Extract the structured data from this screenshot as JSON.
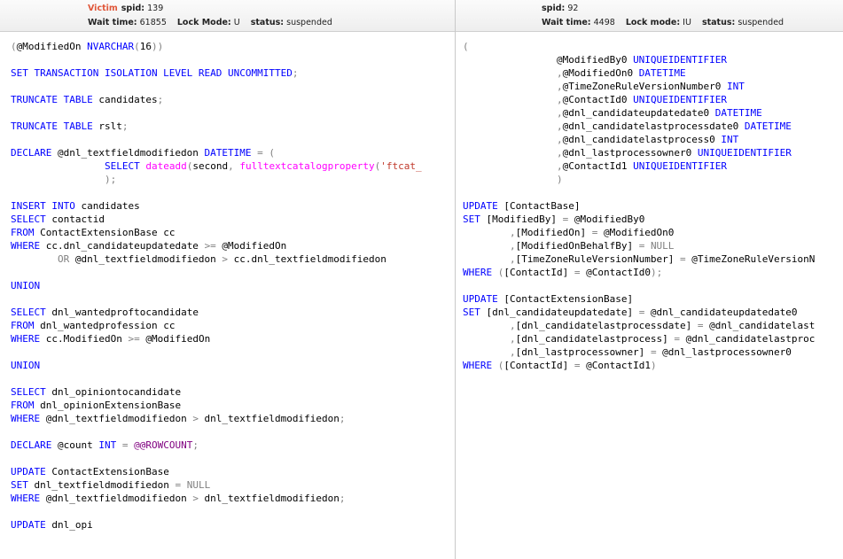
{
  "victim_panel": {
    "victim_label": "Victim",
    "spid_label": "spid:",
    "spid": "139",
    "wait_label": "Wait time:",
    "wait": "61855",
    "lock_label": "Lock Mode:",
    "lock": "U",
    "status_label": "status:",
    "status": "suspended"
  },
  "blocker_panel": {
    "spid_label": "spid:",
    "spid": "92",
    "wait_label": "Wait time:",
    "wait": "4498",
    "lock_label": "Lock mode:",
    "lock": "IU",
    "status_label": "status:",
    "status": "suspended"
  },
  "colors": {
    "keyword": "#0000ff",
    "function": "#ff00ff",
    "string": "#c0392b",
    "operator": "#808080",
    "system_var": "#800080",
    "victim": "#e0573a"
  },
  "left_code": [
    [
      [
        "g",
        "("
      ],
      [
        "t",
        "@ModifiedOn "
      ],
      [
        "k",
        "NVARCHAR"
      ],
      [
        "g",
        "("
      ],
      [
        "t",
        "16"
      ],
      [
        "g",
        "))"
      ]
    ],
    [],
    [
      [
        "k",
        "SET TRANSACTION ISOLATION LEVEL READ UNCOMMITTED"
      ],
      [
        "g",
        ";"
      ]
    ],
    [],
    [
      [
        "k",
        "TRUNCATE TABLE"
      ],
      [
        "t",
        " candidates"
      ],
      [
        "g",
        ";"
      ]
    ],
    [],
    [
      [
        "k",
        "TRUNCATE TABLE"
      ],
      [
        "t",
        " rslt"
      ],
      [
        "g",
        ";"
      ]
    ],
    [],
    [
      [
        "k",
        "DECLARE"
      ],
      [
        "t",
        " @dnl_textfieldmodifiedon "
      ],
      [
        "k",
        "DATETIME"
      ],
      [
        "t",
        " "
      ],
      [
        "g",
        "= ("
      ]
    ],
    [
      [
        "t",
        "                "
      ],
      [
        "k",
        "SELECT"
      ],
      [
        "t",
        " "
      ],
      [
        "f",
        "dateadd"
      ],
      [
        "g",
        "("
      ],
      [
        "t",
        "second"
      ],
      [
        "g",
        ","
      ],
      [
        "t",
        " "
      ],
      [
        "f",
        "fulltextcatalogproperty"
      ],
      [
        "g",
        "("
      ],
      [
        "s",
        "'ftcat_"
      ]
    ],
    [
      [
        "t",
        "                "
      ],
      [
        "g",
        ");"
      ]
    ],
    [],
    [
      [
        "k",
        "INSERT INTO"
      ],
      [
        "t",
        " candidates"
      ]
    ],
    [
      [
        "k",
        "SELECT"
      ],
      [
        "t",
        " contactid"
      ]
    ],
    [
      [
        "k",
        "FROM"
      ],
      [
        "t",
        " ContactExtensionBase cc"
      ]
    ],
    [
      [
        "k",
        "WHERE"
      ],
      [
        "t",
        " cc.dnl_candidateupdatedate "
      ],
      [
        "g",
        ">="
      ],
      [
        "t",
        " @ModifiedOn"
      ]
    ],
    [
      [
        "t",
        "        "
      ],
      [
        "g",
        "OR"
      ],
      [
        "t",
        " @dnl_textfieldmodifiedon "
      ],
      [
        "g",
        ">"
      ],
      [
        "t",
        " cc.dnl_textfieldmodifiedon"
      ]
    ],
    [],
    [
      [
        "k",
        "UNION"
      ]
    ],
    [],
    [
      [
        "k",
        "SELECT"
      ],
      [
        "t",
        " dnl_wantedproftocandidate"
      ]
    ],
    [
      [
        "k",
        "FROM"
      ],
      [
        "t",
        " dnl_wantedprofession cc"
      ]
    ],
    [
      [
        "k",
        "WHERE"
      ],
      [
        "t",
        " cc.ModifiedOn "
      ],
      [
        "g",
        ">="
      ],
      [
        "t",
        " @ModifiedOn"
      ]
    ],
    [],
    [
      [
        "k",
        "UNION"
      ]
    ],
    [],
    [
      [
        "k",
        "SELECT"
      ],
      [
        "t",
        " dnl_opiniontocandidate"
      ]
    ],
    [
      [
        "k",
        "FROM"
      ],
      [
        "t",
        " dnl_opinionExtensionBase"
      ]
    ],
    [
      [
        "k",
        "WHERE"
      ],
      [
        "t",
        " @dnl_textfieldmodifiedon "
      ],
      [
        "g",
        ">"
      ],
      [
        "t",
        " dnl_textfieldmodifiedon"
      ],
      [
        "g",
        ";"
      ]
    ],
    [],
    [
      [
        "k",
        "DECLARE"
      ],
      [
        "t",
        " @count "
      ],
      [
        "k",
        "INT"
      ],
      [
        "t",
        " "
      ],
      [
        "g",
        "="
      ],
      [
        "t",
        " "
      ],
      [
        "v",
        "@@ROWCOUNT"
      ],
      [
        "g",
        ";"
      ]
    ],
    [],
    [
      [
        "k",
        "UPDATE"
      ],
      [
        "t",
        " ContactExtensionBase"
      ]
    ],
    [
      [
        "k",
        "SET"
      ],
      [
        "t",
        " dnl_textfieldmodifiedon "
      ],
      [
        "g",
        "="
      ],
      [
        "t",
        " "
      ],
      [
        "g",
        "NULL"
      ]
    ],
    [
      [
        "k",
        "WHERE"
      ],
      [
        "t",
        " @dnl_textfieldmodifiedon "
      ],
      [
        "g",
        ">"
      ],
      [
        "t",
        " dnl_textfieldmodifiedon"
      ],
      [
        "g",
        ";"
      ]
    ],
    [],
    [
      [
        "k",
        "UPDATE"
      ],
      [
        "t",
        " dnl_opi"
      ]
    ]
  ],
  "right_code": [
    [
      [
        "g",
        "("
      ]
    ],
    [
      [
        "t",
        "                "
      ],
      [
        "t",
        "@ModifiedBy0 "
      ],
      [
        "k",
        "UNIQUEIDENTIFIER"
      ]
    ],
    [
      [
        "t",
        "                "
      ],
      [
        "g",
        ","
      ],
      [
        "t",
        "@ModifiedOn0 "
      ],
      [
        "k",
        "DATETIME"
      ]
    ],
    [
      [
        "t",
        "                "
      ],
      [
        "g",
        ","
      ],
      [
        "t",
        "@TimeZoneRuleVersionNumber0 "
      ],
      [
        "k",
        "INT"
      ]
    ],
    [
      [
        "t",
        "                "
      ],
      [
        "g",
        ","
      ],
      [
        "t",
        "@ContactId0 "
      ],
      [
        "k",
        "UNIQUEIDENTIFIER"
      ]
    ],
    [
      [
        "t",
        "                "
      ],
      [
        "g",
        ","
      ],
      [
        "t",
        "@dnl_candidateupdatedate0 "
      ],
      [
        "k",
        "DATETIME"
      ]
    ],
    [
      [
        "t",
        "                "
      ],
      [
        "g",
        ","
      ],
      [
        "t",
        "@dnl_candidatelastprocessdate0 "
      ],
      [
        "k",
        "DATETIME"
      ]
    ],
    [
      [
        "t",
        "                "
      ],
      [
        "g",
        ","
      ],
      [
        "t",
        "@dnl_candidatelastprocess0 "
      ],
      [
        "k",
        "INT"
      ]
    ],
    [
      [
        "t",
        "                "
      ],
      [
        "g",
        ","
      ],
      [
        "t",
        "@dnl_lastprocessowner0 "
      ],
      [
        "k",
        "UNIQUEIDENTIFIER"
      ]
    ],
    [
      [
        "t",
        "                "
      ],
      [
        "g",
        ","
      ],
      [
        "t",
        "@ContactId1 "
      ],
      [
        "k",
        "UNIQUEIDENTIFIER"
      ]
    ],
    [
      [
        "t",
        "                "
      ],
      [
        "g",
        ")"
      ]
    ],
    [],
    [
      [
        "k",
        "UPDATE"
      ],
      [
        "t",
        " [ContactBase]"
      ]
    ],
    [
      [
        "k",
        "SET"
      ],
      [
        "t",
        " [ModifiedBy] "
      ],
      [
        "g",
        "="
      ],
      [
        "t",
        " @ModifiedBy0"
      ]
    ],
    [
      [
        "t",
        "        "
      ],
      [
        "g",
        ","
      ],
      [
        "t",
        "[ModifiedOn] "
      ],
      [
        "g",
        "="
      ],
      [
        "t",
        " @ModifiedOn0"
      ]
    ],
    [
      [
        "t",
        "        "
      ],
      [
        "g",
        ","
      ],
      [
        "t",
        "[ModifiedOnBehalfBy] "
      ],
      [
        "g",
        "="
      ],
      [
        "t",
        " "
      ],
      [
        "g",
        "NULL"
      ]
    ],
    [
      [
        "t",
        "        "
      ],
      [
        "g",
        ","
      ],
      [
        "t",
        "[TimeZoneRuleVersionNumber] "
      ],
      [
        "g",
        "="
      ],
      [
        "t",
        " @TimeZoneRuleVersionN"
      ]
    ],
    [
      [
        "k",
        "WHERE"
      ],
      [
        "t",
        " "
      ],
      [
        "g",
        "("
      ],
      [
        "t",
        "[ContactId] "
      ],
      [
        "g",
        "="
      ],
      [
        "t",
        " @ContactId0"
      ],
      [
        "g",
        ");"
      ]
    ],
    [],
    [
      [
        "k",
        "UPDATE"
      ],
      [
        "t",
        " [ContactExtensionBase]"
      ]
    ],
    [
      [
        "k",
        "SET"
      ],
      [
        "t",
        " [dnl_candidateupdatedate] "
      ],
      [
        "g",
        "="
      ],
      [
        "t",
        " @dnl_candidateupdatedate0"
      ]
    ],
    [
      [
        "t",
        "        "
      ],
      [
        "g",
        ","
      ],
      [
        "t",
        "[dnl_candidatelastprocessdate] "
      ],
      [
        "g",
        "="
      ],
      [
        "t",
        " @dnl_candidatelast"
      ]
    ],
    [
      [
        "t",
        "        "
      ],
      [
        "g",
        ","
      ],
      [
        "t",
        "[dnl_candidatelastprocess] "
      ],
      [
        "g",
        "="
      ],
      [
        "t",
        " @dnl_candidatelastproc"
      ]
    ],
    [
      [
        "t",
        "        "
      ],
      [
        "g",
        ","
      ],
      [
        "t",
        "[dnl_lastprocessowner] "
      ],
      [
        "g",
        "="
      ],
      [
        "t",
        " @dnl_lastprocessowner0"
      ]
    ],
    [
      [
        "k",
        "WHERE"
      ],
      [
        "t",
        " "
      ],
      [
        "g",
        "("
      ],
      [
        "t",
        "[ContactId] "
      ],
      [
        "g",
        "="
      ],
      [
        "t",
        " @ContactId1"
      ],
      [
        "g",
        ")"
      ]
    ]
  ]
}
